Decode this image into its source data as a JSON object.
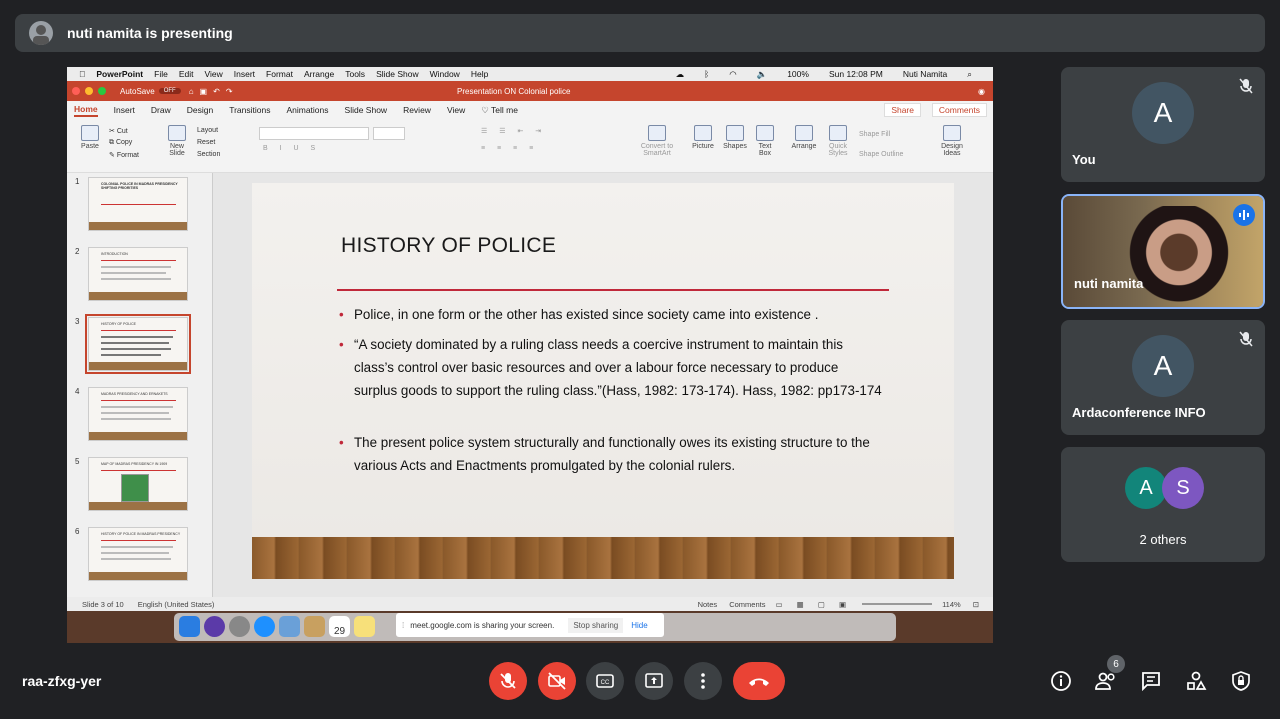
{
  "banner": {
    "text": "nuti namita is presenting"
  },
  "screen": {
    "mac_menu": [
      "PowerPoint",
      "File",
      "Edit",
      "View",
      "Insert",
      "Format",
      "Arrange",
      "Tools",
      "Slide Show",
      "Window",
      "Help"
    ],
    "mac_status": {
      "battery": "100%",
      "time": "Sun 12:08 PM",
      "user": "Nuti Namita"
    },
    "autosave": "AutoSave",
    "autosave_state": "OFF",
    "doc_title": "Presentation ON Colonial police",
    "tabs": [
      "Home",
      "Insert",
      "Draw",
      "Design",
      "Transitions",
      "Animations",
      "Slide Show",
      "Review",
      "View"
    ],
    "tell_me": "Tell me",
    "share": "Share",
    "comments": "Comments",
    "ribbon": {
      "paste": "Paste",
      "cut": "Cut",
      "copy": "Copy",
      "format": "Format",
      "new_slide": "New Slide",
      "layout": "Layout",
      "reset": "Reset",
      "section": "Section",
      "convert": "Convert to SmartArt",
      "picture": "Picture",
      "shapes": "Shapes",
      "textbox": "Text Box",
      "arrange": "Arrange",
      "quick_styles": "Quick Styles",
      "shape_fill": "Shape Fill",
      "shape_outline": "Shape Outline",
      "design_ideas": "Design Ideas"
    },
    "thumbs": [
      {
        "num": "1",
        "title": "COLONIAL POLICE IN MADRAS PRESIDENCY SHIFTING PRIORITIES"
      },
      {
        "num": "2",
        "title": "INTRODUCTION"
      },
      {
        "num": "3",
        "title": "HISTORY OF POLICE"
      },
      {
        "num": "4",
        "title": "MADRAS PRESIDENCY AND ERNAKETS"
      },
      {
        "num": "5",
        "title": "MAP OF MADRAS PRESIDENCY IN 1909"
      },
      {
        "num": "6",
        "title": "HISTORY OF POLICE IN MADRAS PRESIDENCY"
      }
    ],
    "slide": {
      "title": "HISTORY OF POLICE",
      "bullets": [
        "Police, in one form or the other has existed since society came into existence .",
        "“A society dominated by a ruling class needs a coercive instrument to maintain this class’s control over basic resources and over a labour force necessary to produce surplus goods to support the ruling class.”(Hass, 1982: 173-174). Hass, 1982: pp173-174",
        "The present police system structurally and functionally owes its existing structure to the various Acts and Enactments promulgated by the colonial rulers."
      ]
    },
    "status": {
      "slide": "Slide 3 of 10",
      "lang": "English (United States)",
      "notes": "Notes",
      "comments": "Comments",
      "zoom": "114%"
    },
    "sharebar": {
      "text": "meet.google.com is sharing your screen.",
      "stop": "Stop sharing",
      "hide": "Hide"
    },
    "dock_calendar": "29"
  },
  "participants": [
    {
      "name": "You",
      "initial": "A"
    },
    {
      "name": "nuti namita"
    },
    {
      "name": "Ardaconference INFO",
      "initial": "A"
    },
    {
      "name": "2 others",
      "initials": [
        "A",
        "S"
      ]
    }
  ],
  "meeting_code": "raa-zfxg-yer",
  "people_count": "6",
  "colors": {
    "bg": "#202124",
    "tile": "#3c4043",
    "red": "#ea4335",
    "ppt": "#c5452d"
  }
}
